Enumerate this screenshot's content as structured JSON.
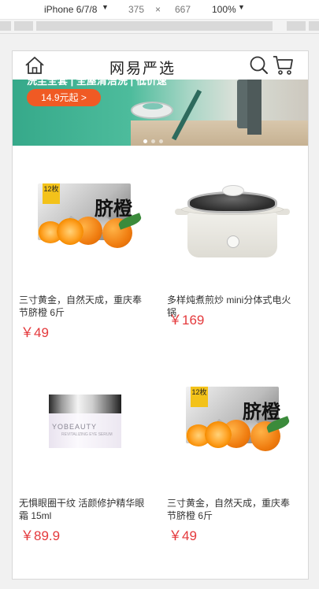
{
  "devtools": {
    "device": "iPhone 6/7/8",
    "width": "375",
    "times": "×",
    "height": "667",
    "zoom": "100%"
  },
  "header": {
    "logo": "网易严选",
    "icons": [
      "home-icon",
      "search-icon",
      "cart-icon"
    ]
  },
  "banner": {
    "cut_text": "洗尘全套 | 全屋清洁洗 | 低价速",
    "price_button": "14.9元起 >",
    "dots": 3,
    "active_dot": 1
  },
  "products": [
    {
      "name": "三寸黄金，自然天成，重庆奉节脐橙 6斤",
      "price": "￥49",
      "image": "navel-orange-box",
      "badge": "12枚",
      "box_text": "脐橙"
    },
    {
      "name": "多样炖煮煎炒 mini分体式电火锅",
      "price": "￥169",
      "image": "electric-hot-pot"
    },
    {
      "name": "无惧眼圈干纹 活颜修护精华眼霜 15ml",
      "price": "￥89.9",
      "image": "eye-cream-jar",
      "jar_label": "YOBEAUTY",
      "jar_sub": "REVITALIZING EYE SERUM"
    },
    {
      "name": "三寸黄金，自然天成，重庆奉节脐橙 6斤",
      "price": "￥49",
      "image": "navel-orange-box",
      "badge": "12枚",
      "box_text": "脐橙"
    }
  ],
  "colors": {
    "price": "#e4393c",
    "banner_button": "#f05a24",
    "banner_green": "#36a98a"
  }
}
